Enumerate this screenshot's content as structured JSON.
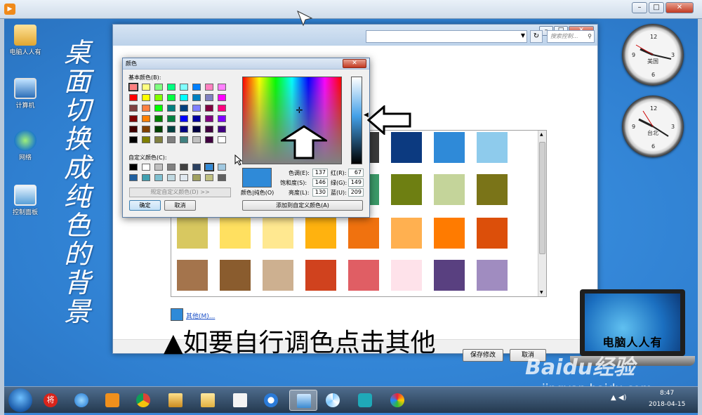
{
  "desktop": {
    "icons": [
      {
        "label": "电脑人人有"
      },
      {
        "label": "计算机"
      },
      {
        "label": "网络"
      },
      {
        "label": "控制面板"
      }
    ],
    "vertical_caption": [
      "桌",
      "面",
      "切",
      "换",
      "成",
      "纯",
      "色",
      "的",
      "背",
      "景"
    ]
  },
  "personalize": {
    "search_placeholder": "搜索控制...",
    "other_link": "其他(M)...",
    "caption": "▲如要自行调色点击其他",
    "save_label": "保存修改",
    "cancel_label": "取消",
    "swatch_colors": [
      [
        "#1a1a1a",
        "#3a3a3a",
        "#0c3a80",
        "#2f8ad8",
        "#8ecbec"
      ],
      [
        "#3f8a78",
        "#3c9a68",
        "#6e7f12",
        "#c4d49a",
        "#7a7418"
      ],
      [
        "#d8c860",
        "#ffe060",
        "#ffe890",
        "#ffb20f",
        "#f0720f",
        "#ffb050",
        "#ff7b00",
        "#dc4f0a"
      ],
      [
        "#a4744c",
        "#8a5c2e",
        "#cdb090",
        "#d0421e",
        "#e05e64",
        "#fee2ea",
        "#594080",
        "#a08cc0"
      ]
    ]
  },
  "color_dialog": {
    "title": "颜色",
    "close_label": "✕",
    "basic_label": "基本颜色(B):",
    "custom_label": "自定义颜色(C):",
    "define_label": "规定自定义颜色(D) >>",
    "ok_label": "确定",
    "cancel_label": "取消",
    "add_label": "添加到自定义颜色(A)",
    "preview_label": "颜色|纯色(O)",
    "fields": {
      "hue": {
        "label": "色调(E):",
        "value": "137"
      },
      "sat": {
        "label": "饱和度(S):",
        "value": "146"
      },
      "lum": {
        "label": "亮度(L):",
        "value": "130"
      },
      "red": {
        "label": "红(R):",
        "value": "67"
      },
      "green": {
        "label": "绿(G):",
        "value": "149"
      },
      "blue": {
        "label": "蓝(U):",
        "value": "209"
      }
    },
    "basic_colors": [
      "#ff8080",
      "#ffff80",
      "#80ff80",
      "#00ff80",
      "#80ffff",
      "#0080ff",
      "#ff80c0",
      "#ff80ff",
      "#ff0000",
      "#ffff00",
      "#80ff00",
      "#00ff40",
      "#00ffff",
      "#0080c0",
      "#8080c0",
      "#ff00ff",
      "#804040",
      "#ff8040",
      "#00ff00",
      "#008080",
      "#004080",
      "#8080ff",
      "#800040",
      "#ff0080",
      "#800000",
      "#ff8000",
      "#008000",
      "#008040",
      "#0000ff",
      "#0000a0",
      "#800080",
      "#8000ff",
      "#400000",
      "#804000",
      "#004000",
      "#004040",
      "#000080",
      "#000040",
      "#400040",
      "#400080",
      "#000000",
      "#808000",
      "#808040",
      "#808080",
      "#408080",
      "#c0c0c0",
      "#400040",
      "#ffffff"
    ],
    "custom_colors": [
      "#000000",
      "#ffffff",
      "#c0c0c0",
      "#808080",
      "#404040",
      "#2a4060",
      "#2f8ad8",
      "#a0c8e0",
      "#2060a0",
      "#40a0b0",
      "#80c0d0",
      "#c0d8e0",
      "#e0e8f0",
      "#a0a060",
      "#c0c080",
      "#606060"
    ],
    "preview_color": "#2f8ad8"
  },
  "gadgets": {
    "clock1_city": "美国",
    "clock2_city": "台北"
  },
  "laptop_text": "电脑人人有",
  "watermark": {
    "logo": "Baidu经验",
    "url": "jingyan.baidu.com"
  },
  "taskbar": {
    "time": "8:47",
    "date": "2018-04-15",
    "apps": [
      "将",
      "ie",
      "media",
      "chrome",
      "explorer",
      "folder",
      "doc",
      "browser",
      "monitor",
      "pinwheel",
      "headset",
      "paint"
    ]
  }
}
